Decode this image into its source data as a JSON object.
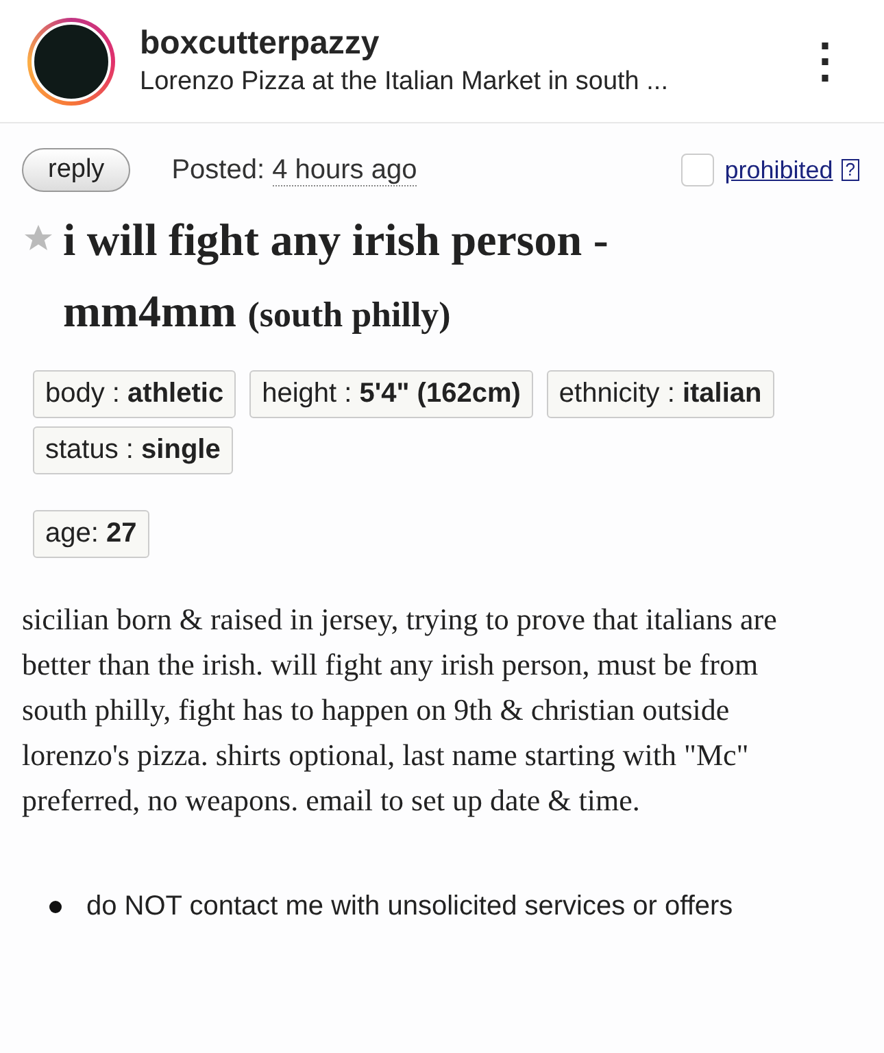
{
  "post_header": {
    "username": "boxcutterpazzy",
    "location": "Lorenzo Pizza at the Italian Market in south ...",
    "more_icon": "⋮"
  },
  "listing": {
    "reply_button": "reply",
    "posted_label": "Posted:",
    "posted_time": "4 hours ago",
    "prohibited_checked": false,
    "prohibited_link": "prohibited",
    "help_mark": "?",
    "favorite": false,
    "title": "i will fight any irish person - mm4mm",
    "area": "(south philly)",
    "attributes": [
      {
        "label": "body :",
        "value": "athletic"
      },
      {
        "label": "height :",
        "value": "5'4\" (162cm)"
      },
      {
        "label": "ethnicity :",
        "value": "italian"
      },
      {
        "label": "status :",
        "value": "single"
      }
    ],
    "age": {
      "label": "age:",
      "value": "27"
    },
    "body": "sicilian born & raised in jersey, trying to prove that italians are better than the irish. will fight any irish person, must be from south philly, fight has to happen on 9th & christian outside lorenzo's pizza. shirts optional, last name starting with \"Mc\" preferred, no weapons. email to set up date & time.",
    "notices": [
      "do NOT contact me with unsolicited services or offers"
    ]
  }
}
